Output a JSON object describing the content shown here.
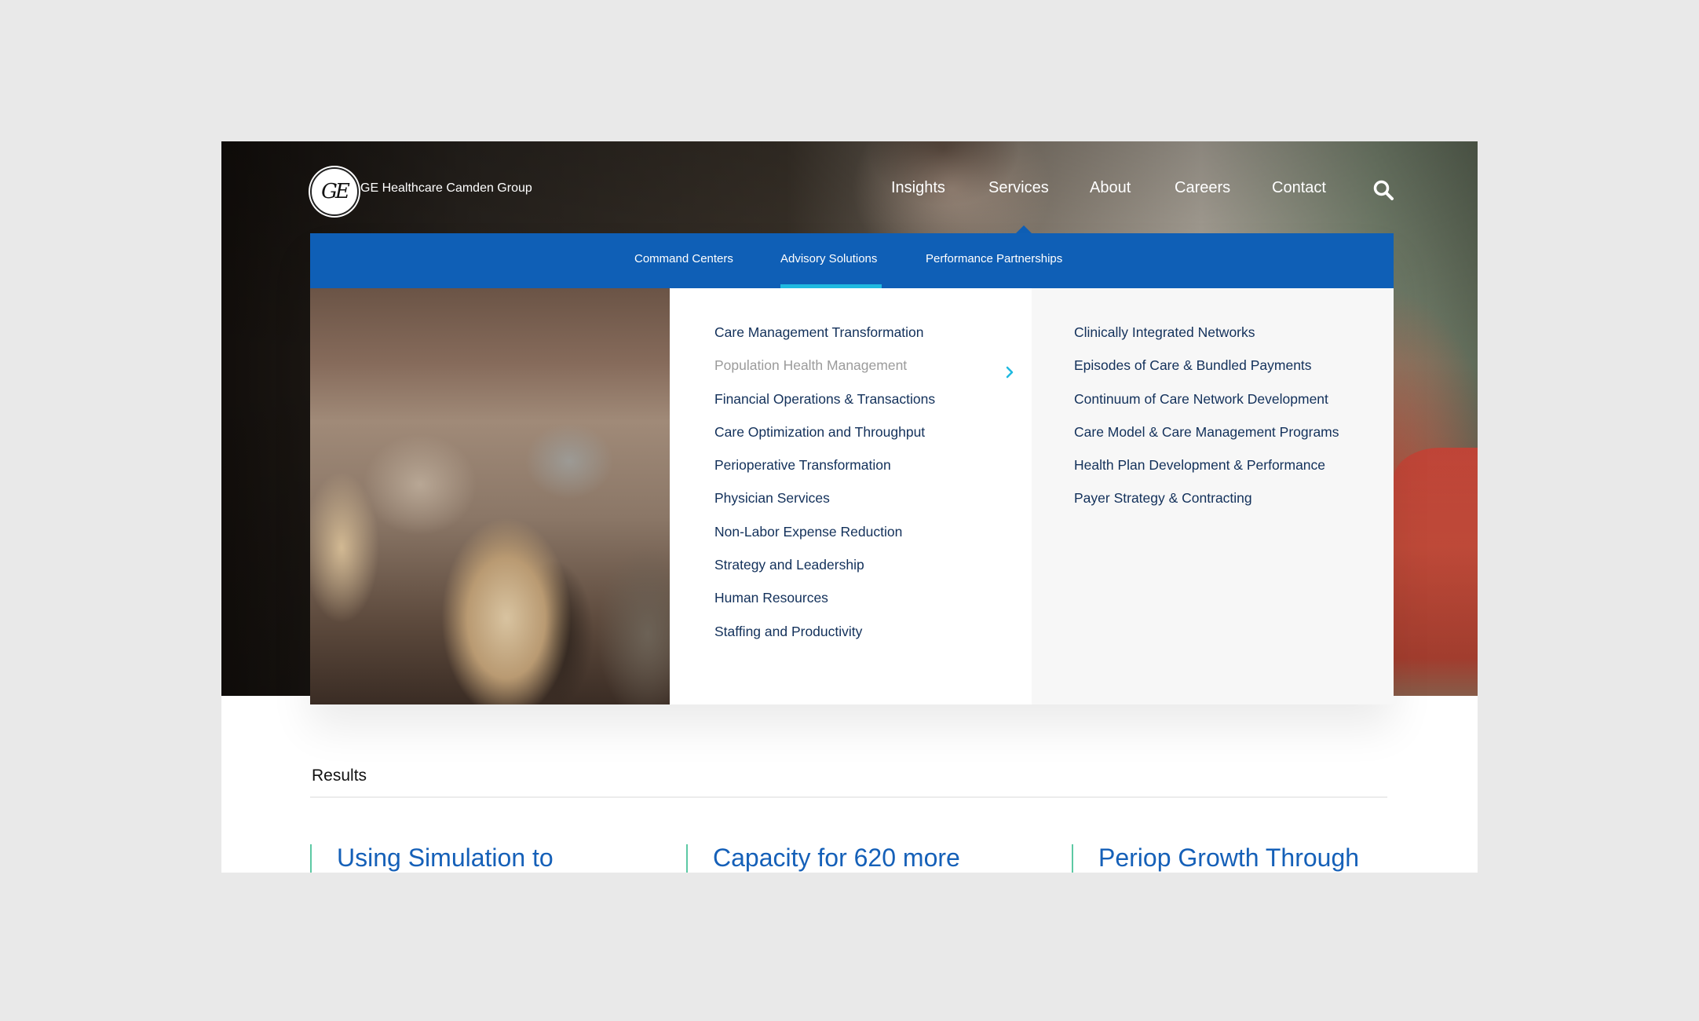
{
  "brand": {
    "logo_icon": "ge-monogram-icon",
    "logo_text": "GE",
    "name": "GE Healthcare Camden Group"
  },
  "nav": {
    "items": [
      {
        "label": "Insights"
      },
      {
        "label": "Services",
        "active": true
      },
      {
        "label": "About"
      },
      {
        "label": "Careers"
      },
      {
        "label": "Contact"
      }
    ],
    "search_icon": "search-icon"
  },
  "services_menu": {
    "tabs": [
      {
        "label": "Command Centers"
      },
      {
        "label": "Advisory Solutions",
        "active": true
      },
      {
        "label": "Performance Partnerships"
      }
    ],
    "primary_items": [
      {
        "label": "Care Management Transformation"
      },
      {
        "label": "Population Health Management",
        "hovered": true,
        "has_submenu": true
      },
      {
        "label": "Financial Operations & Transactions"
      },
      {
        "label": "Care Optimization and Throughput"
      },
      {
        "label": "Perioperative Transformation"
      },
      {
        "label": "Physician Services"
      },
      {
        "label": "Non-Labor Expense Reduction"
      },
      {
        "label": "Strategy and Leadership"
      },
      {
        "label": "Human Resources"
      },
      {
        "label": "Staffing and Productivity"
      }
    ],
    "submenu_items": [
      {
        "label": "Clinically Integrated Networks"
      },
      {
        "label": "Episodes of Care & Bundled Payments"
      },
      {
        "label": "Continuum of Care Network Development"
      },
      {
        "label": "Care Model & Care Management Programs"
      },
      {
        "label": "Health Plan Development & Performance"
      },
      {
        "label": "Payer Strategy & Contracting"
      }
    ],
    "image": "audience-photo"
  },
  "results": {
    "title": "Results",
    "cards": [
      {
        "title": "Using Simulation to"
      },
      {
        "title": "Capacity for 620 more"
      },
      {
        "title": "Periop Growth Through"
      }
    ]
  },
  "colors": {
    "primary_blue": "#0f5fb6",
    "accent_cyan": "#1fb9e0",
    "menu_text": "#12305a",
    "muted_text": "#9b9b9b",
    "card_title": "#1560b8",
    "card_accent": "#5dc9a4",
    "page_bg": "#e9e9e9"
  }
}
